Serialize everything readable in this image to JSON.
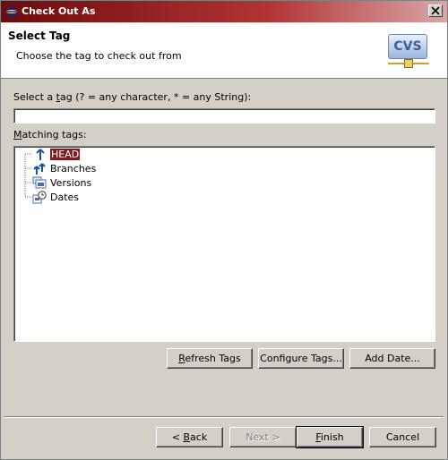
{
  "window": {
    "title": "Check Out As"
  },
  "banner": {
    "title": "Select Tag",
    "description": "Choose the tag to check out from",
    "logo_text": "CVS"
  },
  "filter": {
    "label_prefix": "Select a ",
    "label_underlined": "t",
    "label_rest": "ag (? = any character, * = any String):",
    "value": ""
  },
  "tree": {
    "label_underlined": "M",
    "label_rest": "atching tags:",
    "items": [
      {
        "label": "HEAD",
        "icon": "head-branch-icon",
        "selected": true
      },
      {
        "label": "Branches",
        "icon": "branches-icon",
        "selected": false
      },
      {
        "label": "Versions",
        "icon": "versions-icon",
        "selected": false
      },
      {
        "label": "Dates",
        "icon": "dates-icon",
        "selected": false
      }
    ]
  },
  "tag_buttons": {
    "refresh_u": "R",
    "refresh_rest": "efresh Tags",
    "configure": "Configure Tags...",
    "add_date": "Add Date..."
  },
  "nav_buttons": {
    "back_prefix": "< ",
    "back_u": "B",
    "back_rest": "ack",
    "next": "Next >",
    "finish_u": "F",
    "finish_rest": "inish",
    "cancel": "Cancel"
  },
  "colors": {
    "selection": "#7a1f1f",
    "title_gradient_start": "#6e0b0b"
  }
}
